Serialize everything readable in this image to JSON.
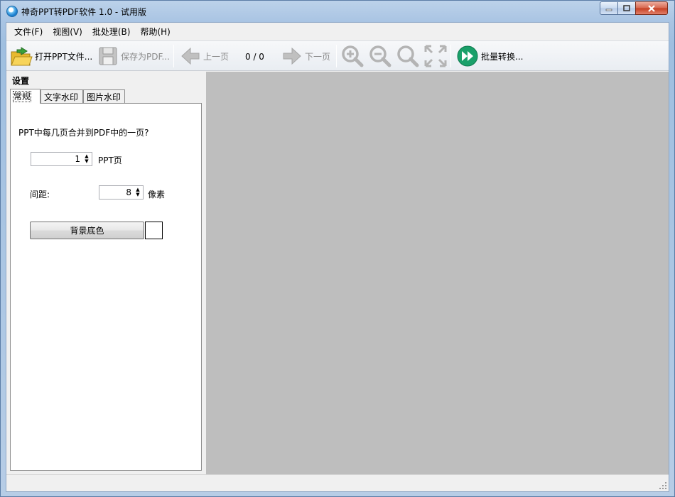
{
  "window": {
    "title": "神奇PPT转PDF软件 1.0 - 试用版"
  },
  "menu": {
    "items": [
      {
        "label": "文件(F)"
      },
      {
        "label": "视图(V)"
      },
      {
        "label": "批处理(B)"
      },
      {
        "label": "帮助(H)"
      }
    ]
  },
  "toolbar": {
    "open_label": "打开PPT文件...",
    "save_label": "保存为PDF...",
    "prev_label": "上一页",
    "page_counter": "0 / 0",
    "next_label": "下一页",
    "batch_label": "批量转换...",
    "icons": [
      "open-folder-icon",
      "save-disk-icon",
      "arrow-left-icon",
      "arrow-right-icon",
      "zoom-in-icon",
      "zoom-out-icon",
      "zoom-reset-icon",
      "fit-screen-icon",
      "fast-forward-icon"
    ]
  },
  "settings": {
    "title": "设置",
    "tabs": [
      {
        "label": "常规"
      },
      {
        "label": "文字水印"
      },
      {
        "label": "图片水印"
      }
    ],
    "general": {
      "question": "PPT中每几页合并到PDF中的一页?",
      "pages_value": "1",
      "pages_unit": "PPT页",
      "spacing_label": "间距:",
      "spacing_value": "8",
      "spacing_unit": "像素",
      "bg_button": "背景底色",
      "bg_color": "#ffffff"
    }
  },
  "colors": {
    "preview_bg": "#bebebe",
    "panel_bg": "#f0f0f0",
    "accent_green": "#1aa06a"
  }
}
